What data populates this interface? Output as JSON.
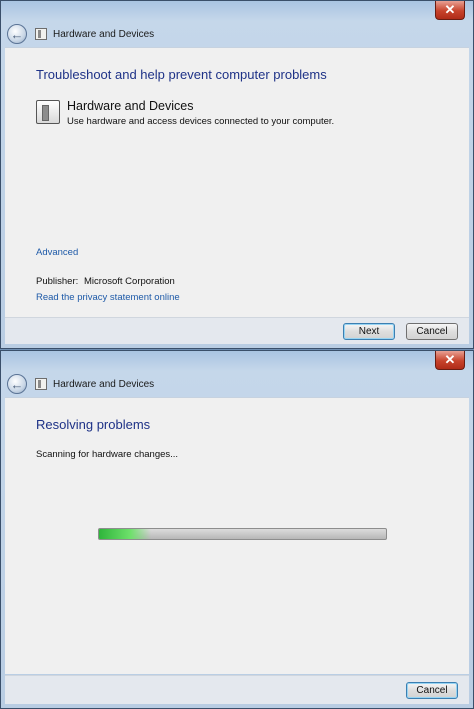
{
  "window1": {
    "title": "Hardware and Devices",
    "close_glyph": "✕",
    "back_glyph": "←",
    "heading": "Troubleshoot and help prevent computer problems",
    "item": {
      "title": "Hardware and Devices",
      "description": "Use hardware and access devices connected to your computer.",
      "icon": "hardware-devices-icon"
    },
    "advanced_link": "Advanced",
    "publisher_label": "Publisher:",
    "publisher_value": "Microsoft Corporation",
    "privacy_link": "Read the privacy statement online",
    "next_button": "Next",
    "cancel_button": "Cancel"
  },
  "window2": {
    "title": "Hardware and Devices",
    "close_glyph": "✕",
    "back_glyph": "←",
    "heading": "Resolving problems",
    "status": "Scanning for hardware changes...",
    "progress_fraction": 0.18,
    "cancel_button": "Cancel"
  },
  "colors": {
    "heading": "#1e3287",
    "link": "#1e5aa8",
    "progress": "#2fb53b",
    "close_button": "#c7432c"
  }
}
